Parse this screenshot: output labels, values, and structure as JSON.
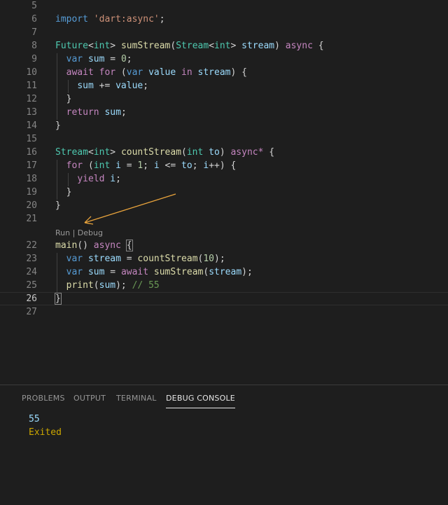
{
  "editor": {
    "codelens": {
      "run": "Run",
      "sep": " | ",
      "debug": "Debug"
    },
    "lines": [
      {
        "n": "5",
        "tokens": []
      },
      {
        "n": "6",
        "tokens": [
          [
            "k",
            "import"
          ],
          [
            "p",
            " "
          ],
          [
            "s",
            "'dart:async'"
          ],
          [
            "p",
            ";"
          ]
        ]
      },
      {
        "n": "7",
        "tokens": []
      },
      {
        "n": "8",
        "tokens": [
          [
            "t",
            "Future"
          ],
          [
            "p",
            "<"
          ],
          [
            "t",
            "int"
          ],
          [
            "p",
            "> "
          ],
          [
            "f",
            "sumStream"
          ],
          [
            "p",
            "("
          ],
          [
            "t",
            "Stream"
          ],
          [
            "p",
            "<"
          ],
          [
            "t",
            "int"
          ],
          [
            "p",
            "> "
          ],
          [
            "v",
            "stream"
          ],
          [
            "p",
            ") "
          ],
          [
            "c",
            "async"
          ],
          [
            "p",
            " {"
          ]
        ]
      },
      {
        "n": "9",
        "tokens": [
          [
            "p",
            "  "
          ],
          [
            "k",
            "var"
          ],
          [
            "p",
            " "
          ],
          [
            "v",
            "sum"
          ],
          [
            "p",
            " = "
          ],
          [
            "n",
            "0"
          ],
          [
            "p",
            ";"
          ]
        ]
      },
      {
        "n": "10",
        "tokens": [
          [
            "p",
            "  "
          ],
          [
            "c",
            "await"
          ],
          [
            "p",
            " "
          ],
          [
            "c",
            "for"
          ],
          [
            "p",
            " ("
          ],
          [
            "k",
            "var"
          ],
          [
            "p",
            " "
          ],
          [
            "v",
            "value"
          ],
          [
            "p",
            " "
          ],
          [
            "c",
            "in"
          ],
          [
            "p",
            " "
          ],
          [
            "v",
            "stream"
          ],
          [
            "p",
            ") {"
          ]
        ]
      },
      {
        "n": "11",
        "tokens": [
          [
            "p",
            "    "
          ],
          [
            "v",
            "sum"
          ],
          [
            "p",
            " += "
          ],
          [
            "v",
            "value"
          ],
          [
            "p",
            ";"
          ]
        ]
      },
      {
        "n": "12",
        "tokens": [
          [
            "p",
            "  }"
          ]
        ]
      },
      {
        "n": "13",
        "tokens": [
          [
            "p",
            "  "
          ],
          [
            "c",
            "return"
          ],
          [
            "p",
            " "
          ],
          [
            "v",
            "sum"
          ],
          [
            "p",
            ";"
          ]
        ]
      },
      {
        "n": "14",
        "tokens": [
          [
            "p",
            "}"
          ]
        ]
      },
      {
        "n": "15",
        "tokens": []
      },
      {
        "n": "16",
        "tokens": [
          [
            "t",
            "Stream"
          ],
          [
            "p",
            "<"
          ],
          [
            "t",
            "int"
          ],
          [
            "p",
            "> "
          ],
          [
            "f",
            "countStream"
          ],
          [
            "p",
            "("
          ],
          [
            "t",
            "int"
          ],
          [
            "p",
            " "
          ],
          [
            "v",
            "to"
          ],
          [
            "p",
            ") "
          ],
          [
            "c",
            "async*"
          ],
          [
            "p",
            " {"
          ]
        ]
      },
      {
        "n": "17",
        "tokens": [
          [
            "p",
            "  "
          ],
          [
            "c",
            "for"
          ],
          [
            "p",
            " ("
          ],
          [
            "t",
            "int"
          ],
          [
            "p",
            " "
          ],
          [
            "v",
            "i"
          ],
          [
            "p",
            " = "
          ],
          [
            "n",
            "1"
          ],
          [
            "p",
            "; "
          ],
          [
            "v",
            "i"
          ],
          [
            "p",
            " <= "
          ],
          [
            "v",
            "to"
          ],
          [
            "p",
            "; "
          ],
          [
            "v",
            "i"
          ],
          [
            "p",
            "++) {"
          ]
        ]
      },
      {
        "n": "18",
        "tokens": [
          [
            "p",
            "    "
          ],
          [
            "c",
            "yield"
          ],
          [
            "p",
            " "
          ],
          [
            "v",
            "i"
          ],
          [
            "p",
            ";"
          ]
        ]
      },
      {
        "n": "19",
        "tokens": [
          [
            "p",
            "  }"
          ]
        ]
      },
      {
        "n": "20",
        "tokens": [
          [
            "p",
            "}"
          ]
        ]
      },
      {
        "n": "21",
        "tokens": []
      },
      {
        "n": "22",
        "tokens": [
          [
            "f",
            "main"
          ],
          [
            "p",
            "() "
          ],
          [
            "c",
            "async"
          ],
          [
            "p",
            " "
          ],
          [
            "hl",
            "{"
          ]
        ]
      },
      {
        "n": "23",
        "tokens": [
          [
            "p",
            "  "
          ],
          [
            "k",
            "var"
          ],
          [
            "p",
            " "
          ],
          [
            "v",
            "stream"
          ],
          [
            "p",
            " = "
          ],
          [
            "f",
            "countStream"
          ],
          [
            "p",
            "("
          ],
          [
            "n",
            "10"
          ],
          [
            "p",
            ");"
          ]
        ]
      },
      {
        "n": "24",
        "tokens": [
          [
            "p",
            "  "
          ],
          [
            "k",
            "var"
          ],
          [
            "p",
            " "
          ],
          [
            "v",
            "sum"
          ],
          [
            "p",
            " = "
          ],
          [
            "c",
            "await"
          ],
          [
            "p",
            " "
          ],
          [
            "f",
            "sumStream"
          ],
          [
            "p",
            "("
          ],
          [
            "v",
            "stream"
          ],
          [
            "p",
            ");"
          ]
        ]
      },
      {
        "n": "25",
        "tokens": [
          [
            "p",
            "  "
          ],
          [
            "f",
            "print"
          ],
          [
            "p",
            "("
          ],
          [
            "v",
            "sum"
          ],
          [
            "p",
            "); "
          ],
          [
            "cm",
            "// 55"
          ]
        ]
      },
      {
        "n": "26",
        "tokens": [
          [
            "hl",
            "}"
          ]
        ]
      },
      {
        "n": "27",
        "tokens": []
      }
    ]
  },
  "panel": {
    "tabs": [
      {
        "label": "PROBLEMS",
        "active": false
      },
      {
        "label": "OUTPUT",
        "active": false
      },
      {
        "label": "TERMINAL",
        "active": false
      },
      {
        "label": "DEBUG CONSOLE",
        "active": true
      }
    ],
    "console": {
      "output": "55",
      "status": "Exited"
    }
  },
  "colors": {
    "background": "#1e1e1e",
    "keyword": "#569cd6",
    "control": "#c586c0",
    "type": "#4ec9b0",
    "function": "#dcdcaa",
    "variable": "#9cdcfe",
    "string": "#ce9178",
    "number": "#b5cea8",
    "comment": "#6a9955",
    "annotation_arrow": "#e8a33c"
  }
}
